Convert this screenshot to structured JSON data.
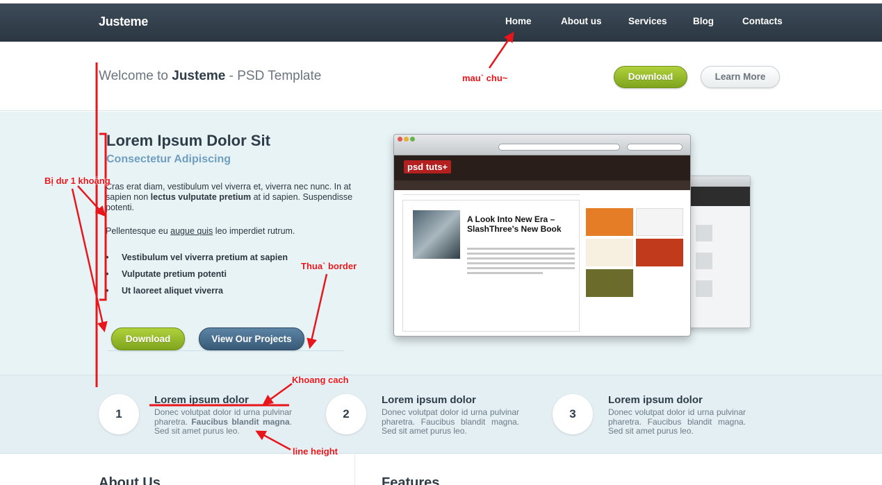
{
  "header": {
    "logo": "Justeme",
    "nav": [
      "Home",
      "About us",
      "Services",
      "Blog",
      "Contacts"
    ]
  },
  "welcome": {
    "prefix": "Welcome to ",
    "brand": "Justeme",
    "suffix": " - PSD Template",
    "download_label": "Download",
    "learn_more_label": "Learn More"
  },
  "hero": {
    "title": "Lorem Ipsum Dolor Sit",
    "subtitle": "Consectetur Adipiscing",
    "p1_a": "Cras erat diam, vestibulum vel viverra et, viverra nec nunc. In at sapien non ",
    "p1_bold": "lectus vulputate pretium",
    "p1_b": " at id sapien. Suspendisse potenti.",
    "p2_a": "Pellentesque eu ",
    "p2_link": "augue quis",
    "p2_b": " leo imperdiet rutrum.",
    "bullets": [
      "Vestibulum vel viverra pretium at sapien",
      "Vulputate pretium potenti",
      "Ut laoreet aliquet viverra"
    ],
    "download_label": "Download",
    "projects_label": "View Our Projects"
  },
  "mockup": {
    "site_logo": "psd tuts+",
    "headline": "A Look Into New Era – SlashThree's New Book"
  },
  "steps": [
    {
      "number": "1",
      "title": "Lorem ipsum dolor",
      "text_a": "Donec volutpat dolor id urna pulvinar pharetra. ",
      "text_bold": "Faucibus blandit magna",
      "text_b": ". Sed sit amet purus leo."
    },
    {
      "number": "2",
      "title": "Lorem ipsum dolor",
      "text_a": "Donec volutpat dolor id urna pulvinar pharetra. Faucibus blandit magna. Sed sit amet purus leo.",
      "text_bold": "",
      "text_b": ""
    },
    {
      "number": "3",
      "title": "Lorem ipsum dolor",
      "text_a": "Donec volutpat dolor id urna pulvinar pharetra. Faucibus blandit magna. Sed sit amet purus leo.",
      "text_bold": "",
      "text_b": ""
    }
  ],
  "bottom": {
    "about": "About Us",
    "features": "Features"
  },
  "annotations": {
    "color": "mau` chu~",
    "gap": "Bị dư 1 khoảng",
    "border": "Thua` border",
    "spacing": "Khoang cach",
    "line_height": "line height"
  },
  "colors": {
    "nav_bg": "#2f3b46",
    "green": "#8db52a",
    "blue": "#46688a",
    "annotation": "#e8151b"
  }
}
